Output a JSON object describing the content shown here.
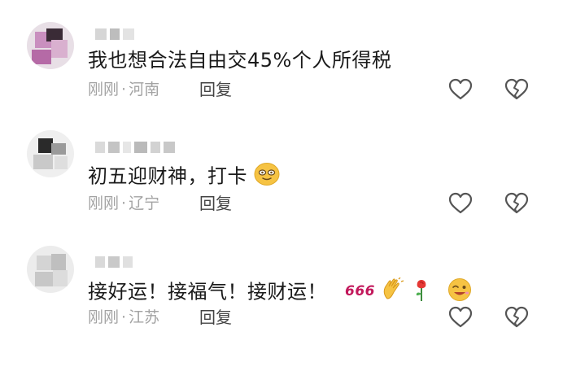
{
  "comments": [
    {
      "text": "我也想合法自由交45%个人所得税",
      "time": "刚刚",
      "separator": "·",
      "location": "河南",
      "reply_label": "回复"
    },
    {
      "text": "初五迎财神，打卡",
      "time": "刚刚",
      "separator": "·",
      "location": "辽宁",
      "reply_label": "回复"
    },
    {
      "text": "接好运！接福气！接财运！",
      "time": "刚刚",
      "separator": "·",
      "location": "江苏",
      "reply_label": "回复",
      "emoji_666": "666"
    }
  ],
  "icons": {
    "like": "heart-outline-icon",
    "dislike": "broken-heart-icon"
  },
  "colors": {
    "text": "#1a1a1a",
    "meta": "#a3a3a3",
    "reply": "#444444",
    "icon": "#555555",
    "emoji_666": "#c2185b",
    "emoji_face": "#f6c343"
  }
}
